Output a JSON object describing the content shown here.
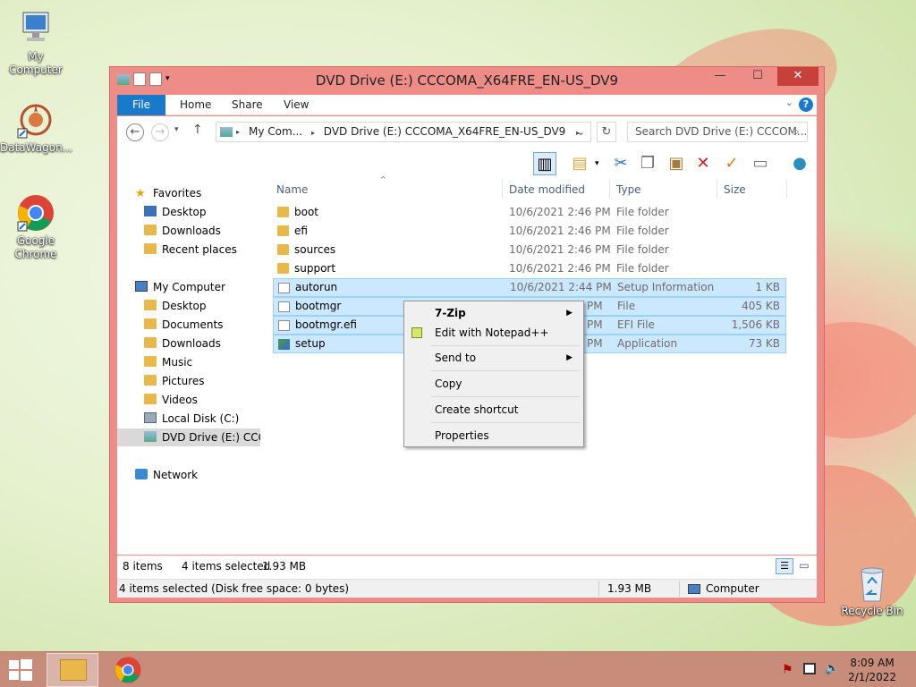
{
  "desktop": {
    "icons": [
      {
        "label": "My Computer"
      },
      {
        "label": "DataWagon..."
      },
      {
        "label": "Google Chrome"
      },
      {
        "label": "Recycle Bin"
      }
    ]
  },
  "window": {
    "title": "DVD Drive (E:) CCCOMA_X64FRE_EN-US_DV9",
    "ribbon_tabs": [
      "File",
      "Home",
      "Share",
      "View"
    ],
    "address": {
      "crumbs": [
        "My Com...",
        "DVD Drive (E:) CCCOMA_X64FRE_EN-US_DV9"
      ],
      "search_placeholder": "Search DVD Drive (E:) CCCOM..."
    },
    "nav_pane": {
      "favorites": {
        "label": "Favorites",
        "items": [
          "Desktop",
          "Downloads",
          "Recent places"
        ]
      },
      "computer": {
        "label": "My Computer",
        "items": [
          "Desktop",
          "Documents",
          "Downloads",
          "Music",
          "Pictures",
          "Videos",
          "Local Disk (C:)",
          "DVD Drive (E:) CCCC"
        ]
      },
      "network": {
        "label": "Network"
      }
    },
    "columns": [
      "Name",
      "Date modified",
      "Type",
      "Size"
    ],
    "files": [
      {
        "name": "boot",
        "date": "10/6/2021 2:46 PM",
        "type": "File folder",
        "size": "",
        "kind": "folder",
        "selected": false
      },
      {
        "name": "efi",
        "date": "10/6/2021 2:46 PM",
        "type": "File folder",
        "size": "",
        "kind": "folder",
        "selected": false
      },
      {
        "name": "sources",
        "date": "10/6/2021 2:46 PM",
        "type": "File folder",
        "size": "",
        "kind": "folder",
        "selected": false
      },
      {
        "name": "support",
        "date": "10/6/2021 2:46 PM",
        "type": "File folder",
        "size": "",
        "kind": "folder",
        "selected": false
      },
      {
        "name": "autorun",
        "date": "10/6/2021 2:44 PM",
        "type": "Setup Information",
        "size": "1 KB",
        "kind": "inf",
        "selected": true
      },
      {
        "name": "bootmgr",
        "date": "",
        "type": "File",
        "size": "405 KB",
        "kind": "file",
        "selected": true
      },
      {
        "name": "bootmgr.efi",
        "date": "",
        "type": "EFI File",
        "size": "1,506 KB",
        "kind": "file",
        "selected": true
      },
      {
        "name": "setup",
        "date": "",
        "type": "Application",
        "size": "73 KB",
        "kind": "app",
        "selected": true
      }
    ],
    "partial_dates": [
      "PM",
      "PM",
      "PM"
    ],
    "status": {
      "count": "8 items",
      "selected": "4 items selected",
      "size": "1.93 MB"
    },
    "status_line": {
      "left": "4 items selected (Disk free space: 0 bytes)",
      "size": "1.93 MB",
      "location": "Computer"
    }
  },
  "context_menu": {
    "items": [
      {
        "label": "7-Zip",
        "submenu": true,
        "bold": true
      },
      {
        "label": "Edit with Notepad++",
        "submenu": false
      },
      {
        "label": "Send to",
        "submenu": true
      },
      {
        "label": "Copy",
        "submenu": false
      },
      {
        "label": "Create shortcut",
        "submenu": false
      },
      {
        "label": "Properties",
        "submenu": false
      }
    ]
  },
  "taskbar": {
    "time": "8:09 AM",
    "date": "2/1/2022"
  },
  "colors": {
    "window_frame": "#ee8d87",
    "close_button": "#c7403a",
    "file_tab": "#1979ca",
    "selection": "#cce8ff",
    "taskbar": "#c78c7a"
  }
}
